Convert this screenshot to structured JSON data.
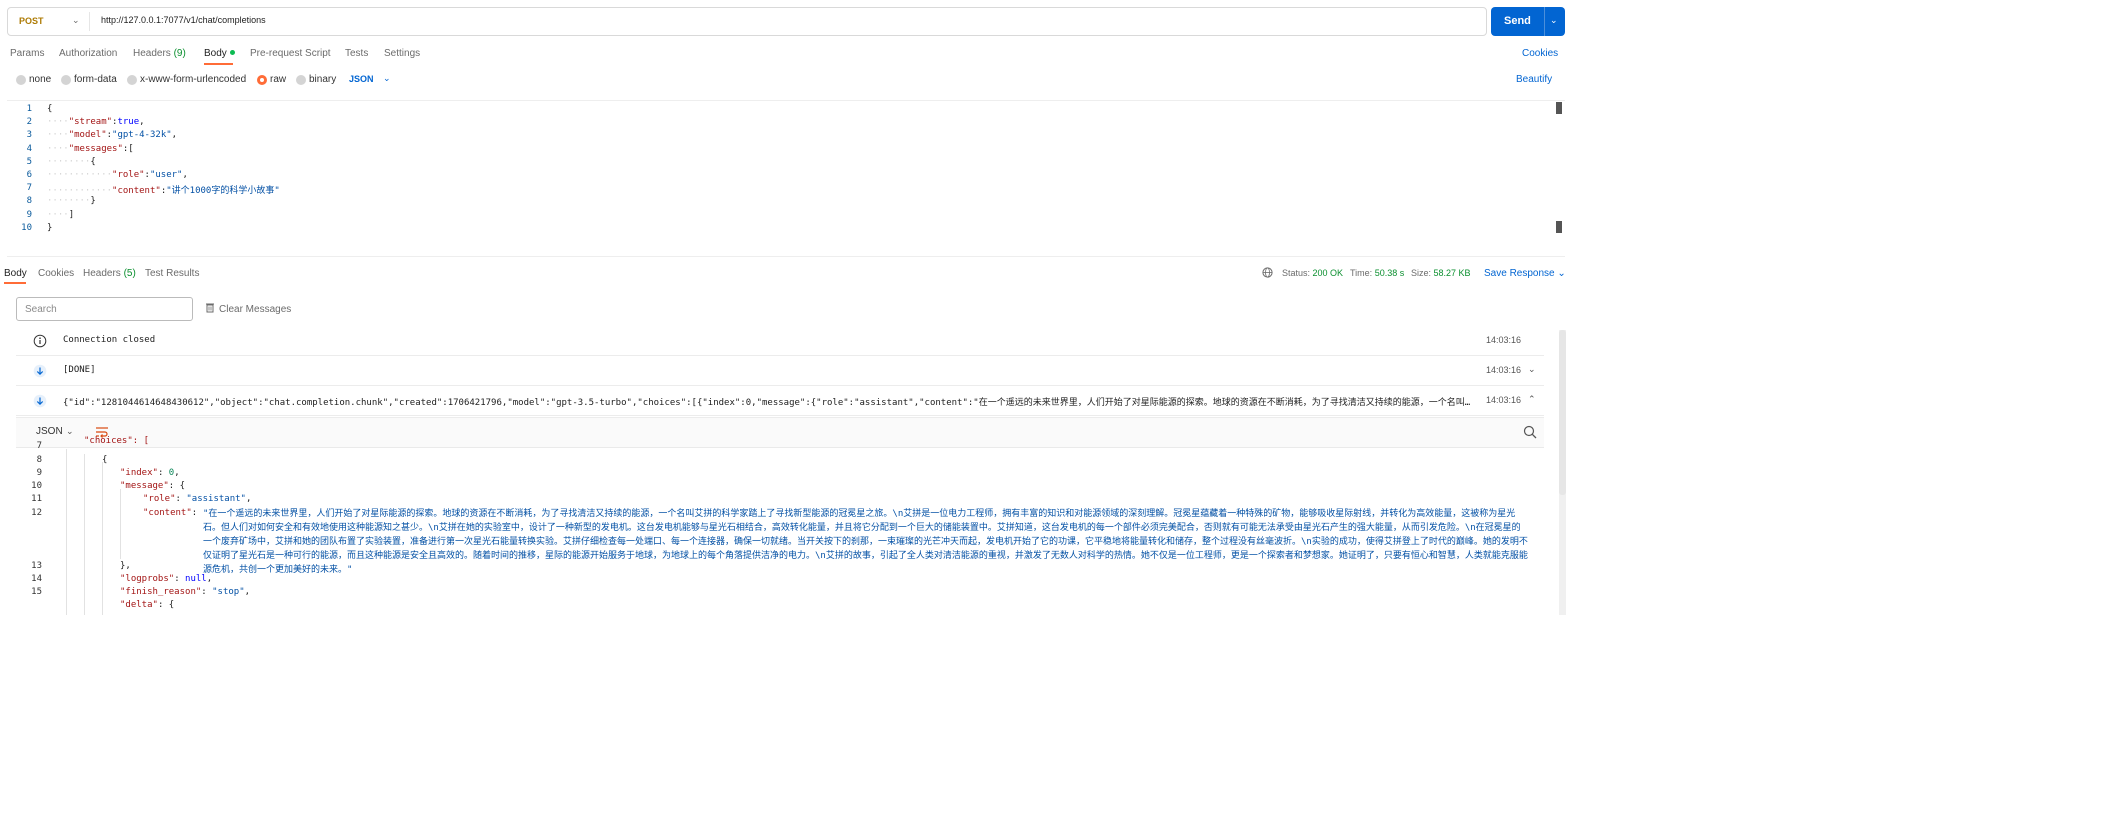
{
  "request": {
    "method": "POST",
    "url": "http://127.0.0.1:7077/v1/chat/completions",
    "send_label": "Send"
  },
  "request_tabs": {
    "params": "Params",
    "authorization": "Authorization",
    "headers": "Headers",
    "headers_count": "(9)",
    "body": "Body",
    "pre_request": "Pre-request Script",
    "tests": "Tests",
    "settings": "Settings",
    "cookies": "Cookies"
  },
  "body_types": {
    "none": "none",
    "form_data": "form-data",
    "urlencoded": "x-www-form-urlencoded",
    "raw": "raw",
    "binary": "binary",
    "selected": "raw",
    "format": "JSON",
    "beautify": "Beautify"
  },
  "editor": {
    "line_numbers": [
      "1",
      "2",
      "3",
      "4",
      "5",
      "6",
      "7",
      "8",
      "9",
      "10"
    ],
    "brace_open": "{",
    "stream_key": "\"stream\"",
    "stream_val": "true",
    "model_key": "\"model\"",
    "model_val": "\"gpt-4-32k\"",
    "messages_key": "\"messages\"",
    "bracket_open": "[",
    "obj_open": "{",
    "role_key": "\"role\"",
    "role_val": "\"user\"",
    "content_key": "\"content\"",
    "content_val": "\"讲个1000字的科学小故事\"",
    "obj_close": "}",
    "bracket_close": "]",
    "brace_close": "}"
  },
  "response_tabs": {
    "body": "Body",
    "cookies": "Cookies",
    "headers": "Headers",
    "headers_count": "(5)",
    "test_results": "Test Results"
  },
  "response_meta": {
    "status_label": "Status:",
    "status_value": "200 OK",
    "time_label": "Time:",
    "time_value": "50.38 s",
    "size_label": "Size:",
    "size_value": "58.27 KB",
    "save": "Save Response"
  },
  "messages_panel": {
    "search_placeholder": "Search",
    "clear": "Clear Messages",
    "rows": [
      {
        "text": "Connection closed",
        "time": "14:03:16",
        "icon": "info-icon"
      },
      {
        "text": "[DONE]",
        "time": "14:03:16",
        "icon": "arrow-down-icon"
      },
      {
        "text": "{\"id\":\"1281044614648430612\",\"object\":\"chat.completion.chunk\",\"created\":1706421796,\"model\":\"gpt-3.5-turbo\",\"choices\":[{\"index\":0,\"message\":{\"role\":\"assistant\",\"content\":\"在一个遥远的未来世界里，人们开始了对星际能源的探索。地球的资源在不断消耗，为了寻找清洁又持续的能源，一个名叫艾拼...",
        "time": "14:03:16",
        "icon": "arrow-down-icon"
      }
    ]
  },
  "viewer": {
    "format": "JSON",
    "line_numbers": [
      "7",
      "8",
      "9",
      "10",
      "11",
      "12",
      "13",
      "14",
      "15"
    ],
    "choices_key": "\"choices\": [",
    "brace_open": "{",
    "index_key": "\"index\"",
    "index_val": "0",
    "message_key": "\"message\"",
    "role_key": "\"role\"",
    "role_val": "\"assistant\"",
    "content_key": "\"content\"",
    "content_val": "\"在一个遥远的未来世界里，人们开始了对星际能源的探索。地球的资源在不断消耗，为了寻找清洁又持续的能源，一个名叫艾拼的科学家踏上了寻找新型能源的冠冕星之旅。\\n艾拼是一位电力工程师，拥有丰富的知识和对能源领域的深刻理解。冠冕星蕴藏着一种特殊的矿物，能够吸收星际射线，并转化为高效能量，这被称为星光石。但人们对如何安全和有效地使用这种能源知之甚少。\\n艾拼在她的实验室中，设计了一种新型的发电机。这台发电机能够与星光石相结合，高效转化能量，并且将它分配到一个巨大的储能装置中。艾拼知道，这台发电机的每一个部件必须完美配合，否则就有可能无法承受由星光石产生的强大能量，从而引发危险。\\n在冠冕星的一个废弃矿场中，艾拼和她的团队布置了实验装置，准备进行第一次星光石能量转换实验。艾拼仔细检查每一处端口、每一个连接器，确保一切就绪。当开关按下的刹那，一束璀璨的光芒冲天而起，发电机开始了它的功课，它平稳地将能量转化和储存，整个过程没有丝毫波折。\\n实验的成功，使得艾拼登上了时代的巅峰。她的发明不仅证明了星光石是一种可行的能源，而且这种能源是安全且高效的。随着时间的推移，星际的能源开始服务于地球，为地球上的每个角落提供洁净的电力。\\n艾拼的故事，引起了全人类对清洁能源的重视，并激发了无数人对科学的热情。她不仅是一位工程师，更是一个探索者和梦想家。她证明了，只要有恒心和智慧，人类就能克服能源危机，共创一个更加美好的未来。\"",
    "close_brace": "},",
    "logprobs_key": "\"logprobs\"",
    "logprobs_val": "null",
    "finish_key": "\"finish_reason\"",
    "finish_val": "\"stop\"",
    "delta_key": "\"delta\""
  }
}
